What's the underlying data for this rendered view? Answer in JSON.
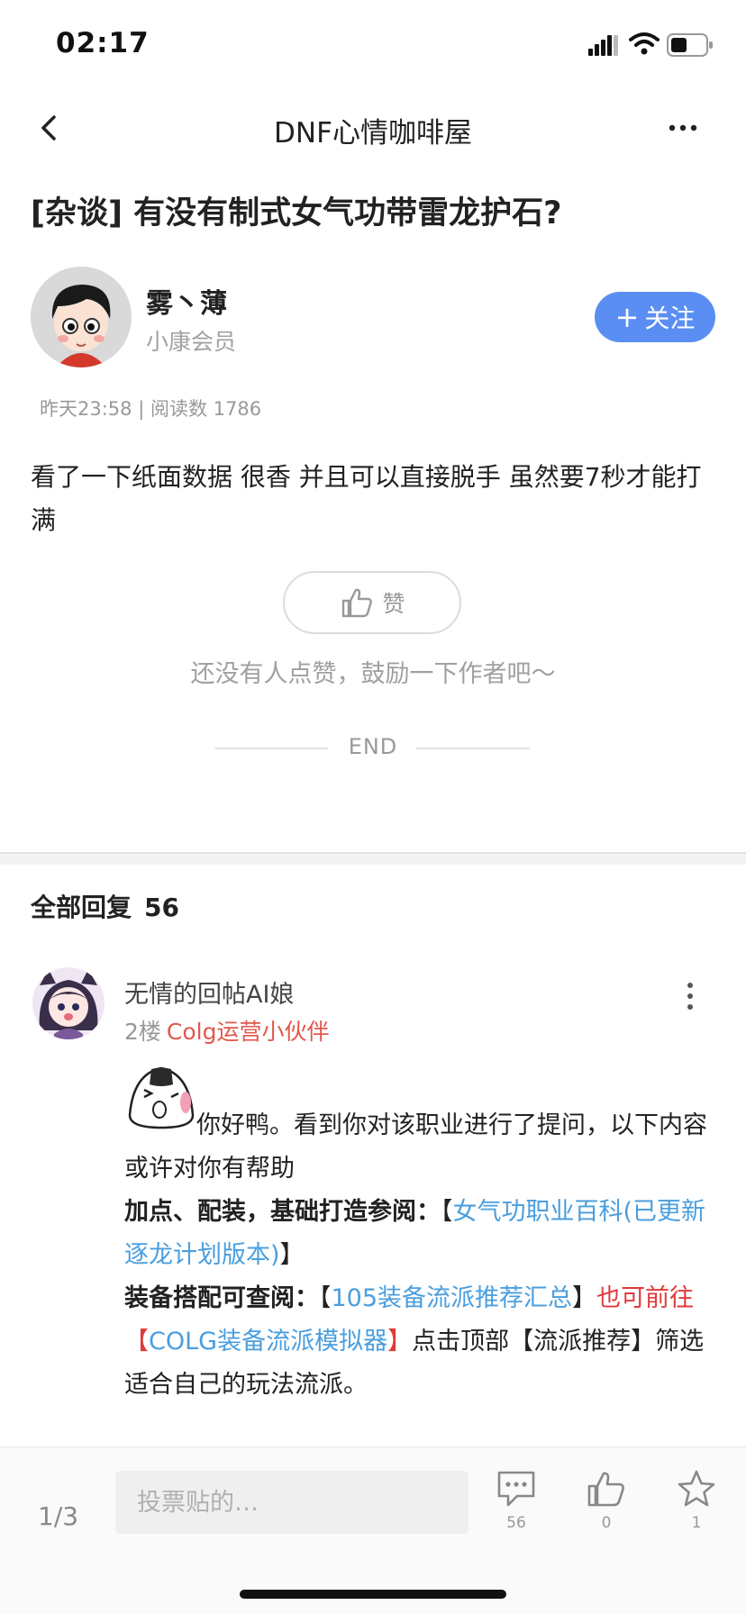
{
  "status_bar": {
    "time": "02:17"
  },
  "nav": {
    "title": "DNF心情咖啡屋"
  },
  "post": {
    "title": "[杂谈] 有没有制式女气功带雷龙护石?",
    "author": {
      "name": "雾丶薄",
      "level": "小康会员"
    },
    "follow_label": "关注",
    "meta": "昨天23:58 | 阅读数 1786",
    "body": "看了一下纸面数据 很香 并且可以直接脱手  虽然要7秒才能打满",
    "like_label": "赞",
    "like_hint": "还没有人点赞，鼓励一下作者吧～",
    "end_label": "END"
  },
  "replies": {
    "header_label": "全部回复",
    "count": "56",
    "items": [
      {
        "username": "无情的回帖AI娘",
        "floor": "2楼",
        "role": "Colg运营小伙伴",
        "text": "你好鸭。看到你对该职业进行了提问，以下内容或许对你有帮助",
        "line2": {
          "label": "加点、配装，基础打造参阅：",
          "bracket_open": "【",
          "link": "女气功职业百科(已更新逐龙计划版本)",
          "bracket_close": "】"
        },
        "line3": {
          "label": "装备搭配可查阅：",
          "bracket_open": "【",
          "link1": "105装备流派推荐汇总",
          "bracket_close": "】",
          "red_text": "也可前往",
          "red_bracket_open": "【",
          "link2": "COLG装备流派模拟器",
          "red_bracket_close": "】",
          "tail": "点击顶部【流派推荐】筛选适合自己的玩法流派。"
        }
      }
    ]
  },
  "bottom_bar": {
    "page_indicator": "1/3",
    "input_placeholder": "投票贴的…",
    "comments_count": "56",
    "likes_count": "0",
    "favorites_count": "1"
  },
  "colors": {
    "accent": "#5a8ef2",
    "link": "#4a9ede",
    "role": "#e2574c",
    "red_text": "#e03a3a"
  },
  "icons": {
    "back": "chevron-left-icon",
    "more": "more-horizontal-icon",
    "like": "thumbs-up-icon",
    "comment": "comment-icon",
    "favorite": "star-icon"
  }
}
